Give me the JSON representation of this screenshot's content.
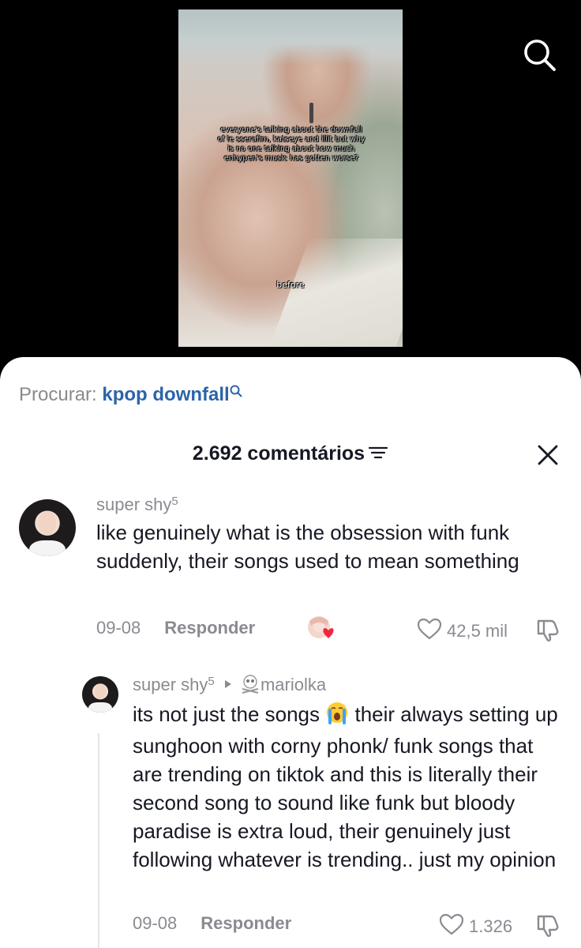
{
  "video": {
    "caption": "everyone's talking about the downfall of le sserafim, katseye and illit but why is no one talking about how much enhypen's music has gotten worse?",
    "caption_bottom": "before"
  },
  "related_search": {
    "label": "Procurar:",
    "query": "kpop downfall"
  },
  "comments_header": {
    "count": "2.692 comentários"
  },
  "comments": [
    {
      "username": "super shy",
      "superscript": "5",
      "text": "like genuinely what is the obsession with funk suddenly, their songs used to mean something",
      "date": "09-08",
      "reply_label": "Responder",
      "likes": "42,5 mil"
    },
    {
      "username": "super shy",
      "superscript": "5",
      "reply_to": "mariolka",
      "text_before_emoji": "its not just the songs",
      "text_after_emoji": "their always setting up sunghoon with corny phonk/ funk songs that are trending on tiktok and this is literally their second song to sound like funk but bloody paradise is extra loud, their genuinely just following whatever is trending.. just my opinion",
      "date": "09-08",
      "reply_label": "Responder",
      "likes": "1.326"
    }
  ],
  "icons": {
    "search": "search-icon",
    "filter": "filter-icon",
    "close": "close-icon",
    "heart": "heart-icon",
    "dislike": "thumbs-down-icon"
  },
  "colors": {
    "query_blue": "#2c64a8",
    "muted_text": "#8a8b91",
    "body_text": "#161823"
  }
}
